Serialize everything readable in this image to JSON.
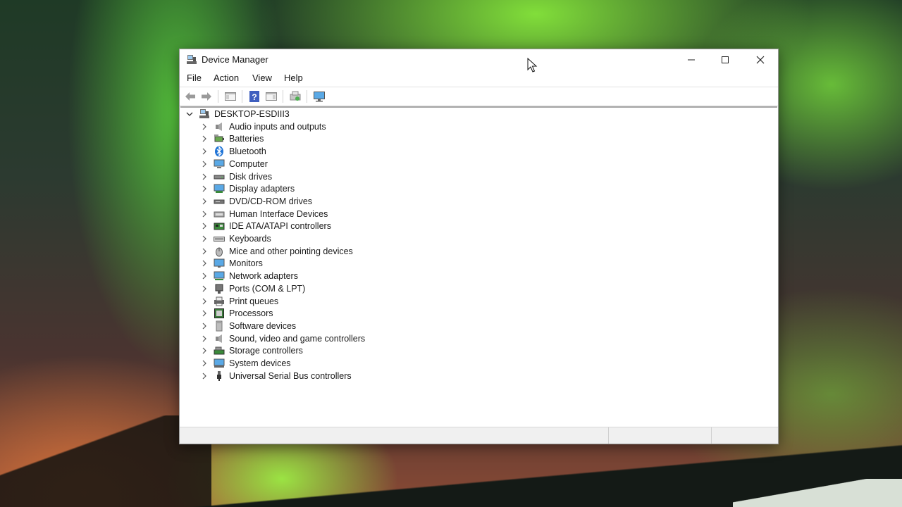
{
  "window": {
    "title": "Device Manager",
    "icon": "device-manager-icon"
  },
  "menubar": {
    "items": [
      "File",
      "Action",
      "View",
      "Help"
    ]
  },
  "toolbar": {
    "buttons": [
      "back-arrow-icon",
      "forward-arrow-icon",
      "show-hide-console-tree-icon",
      "help-icon",
      "properties-icon",
      "scan-hardware-icon",
      "monitor-icon"
    ]
  },
  "tree": {
    "root": "DESKTOP-ESDIII3",
    "categories": [
      {
        "label": "Audio inputs and outputs",
        "icon": "speaker-icon"
      },
      {
        "label": "Batteries",
        "icon": "battery-icon"
      },
      {
        "label": "Bluetooth",
        "icon": "bluetooth-icon"
      },
      {
        "label": "Computer",
        "icon": "computer-icon"
      },
      {
        "label": "Disk drives",
        "icon": "disk-drive-icon"
      },
      {
        "label": "Display adapters",
        "icon": "display-adapter-icon"
      },
      {
        "label": "DVD/CD-ROM drives",
        "icon": "dvd-drive-icon"
      },
      {
        "label": "Human Interface Devices",
        "icon": "hid-icon"
      },
      {
        "label": "IDE ATA/ATAPI controllers",
        "icon": "ide-controller-icon"
      },
      {
        "label": "Keyboards",
        "icon": "keyboard-icon"
      },
      {
        "label": "Mice and other pointing devices",
        "icon": "mouse-icon"
      },
      {
        "label": "Monitors",
        "icon": "monitor-icon"
      },
      {
        "label": "Network adapters",
        "icon": "network-adapter-icon"
      },
      {
        "label": "Ports (COM & LPT)",
        "icon": "port-icon"
      },
      {
        "label": "Print queues",
        "icon": "printer-icon"
      },
      {
        "label": "Processors",
        "icon": "processor-icon"
      },
      {
        "label": "Software devices",
        "icon": "software-device-icon"
      },
      {
        "label": "Sound, video and game controllers",
        "icon": "sound-controller-icon"
      },
      {
        "label": "Storage controllers",
        "icon": "storage-controller-icon"
      },
      {
        "label": "System devices",
        "icon": "system-device-icon"
      },
      {
        "label": "Universal Serial Bus controllers",
        "icon": "usb-icon"
      }
    ]
  },
  "colors": {
    "accent_blue": "#2b7bd6",
    "window_bg": "#ffffff",
    "status_bg": "#f0f0f0"
  }
}
